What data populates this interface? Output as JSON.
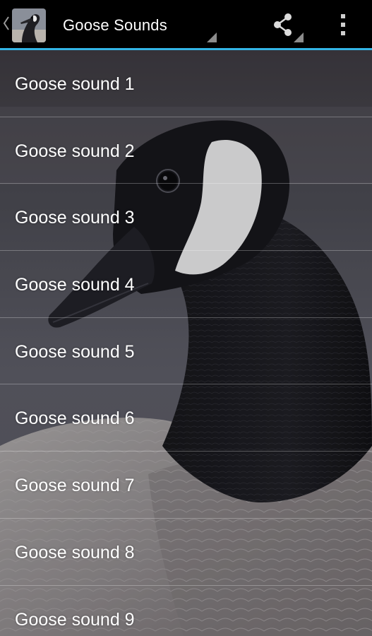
{
  "action_bar": {
    "title": "Goose Sounds",
    "accent_color": "#33b5e5",
    "icons": {
      "up": "chevron-left-icon",
      "app": "goose-app-icon",
      "share": "share-icon",
      "overflow": "more-vert-icon"
    }
  },
  "list": {
    "items": [
      {
        "label": "Goose sound 1"
      },
      {
        "label": "Goose sound 2"
      },
      {
        "label": "Goose sound 3"
      },
      {
        "label": "Goose sound 4"
      },
      {
        "label": "Goose sound 5"
      },
      {
        "label": "Goose sound 6"
      },
      {
        "label": "Goose sound 7"
      },
      {
        "label": "Goose sound 8"
      },
      {
        "label": "Goose sound 9"
      }
    ]
  }
}
